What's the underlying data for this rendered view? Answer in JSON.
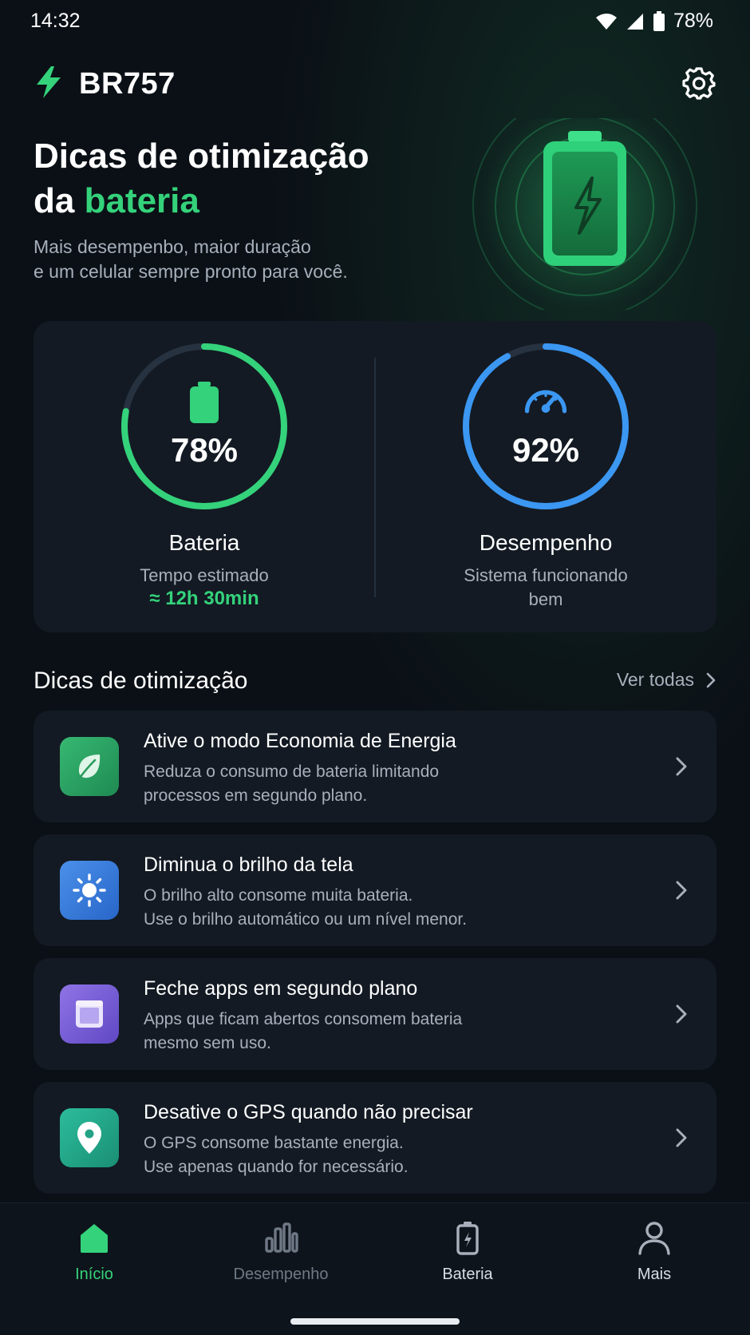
{
  "status_bar": {
    "time": "14:32",
    "battery_percent": "78%"
  },
  "header": {
    "brand": "BR757",
    "icons": [
      "bolt-icon",
      "gear-icon"
    ]
  },
  "hero": {
    "title_line1": "Dicas de otimização",
    "title_line2_prefix": "da ",
    "title_line2_accent": "bateria",
    "subtitle_line1": "Mais desempenbo, maior duração",
    "subtitle_line2": "e um celular sempre pronto para você."
  },
  "stats": {
    "battery": {
      "value_text": "78%",
      "level": 0.78,
      "label": "Bateria",
      "sub": "Tempo estimado",
      "eta": "≈ 12h 30min",
      "color": "#34d27b"
    },
    "performance": {
      "value_text": "92%",
      "level": 0.92,
      "label": "Desempenho",
      "sub_line1": "Sistema funcionando",
      "sub_line2": "bem",
      "color": "#3b97f2"
    }
  },
  "tips_section": {
    "title": "Dicas de otimização",
    "see_all": "Ver todas"
  },
  "tips": [
    {
      "title": "Ative o modo Economia de Energia",
      "desc_line1": "Reduza o consumo de bateria limitando",
      "desc_line2": "processos em segundo plano.",
      "icon": "leaf-icon",
      "color": "#2fae68"
    },
    {
      "title": "Diminua o brilho da tela",
      "desc_line1": "O brilho alto consome muita bateria.",
      "desc_line2": "Use o brilho automático ou um nível menor.",
      "icon": "sun-icon",
      "color": "#3a7fe0"
    },
    {
      "title": "Feche apps em segundo plano",
      "desc_line1": "Apps que ficam abertos consomem bateria",
      "desc_line2": "mesmo sem uso.",
      "icon": "window-icon",
      "color": "#7c63d8"
    },
    {
      "title": "Desative o GPS quando não precisar",
      "desc_line1": "O GPS consome bastante energia.",
      "desc_line2": "Use apenas quando for necessário.",
      "icon": "location-pin-icon",
      "color": "#22a88c"
    }
  ],
  "bottom_nav": {
    "items": [
      {
        "label": "Início",
        "icon": "home-icon",
        "active": true
      },
      {
        "label": "Desempenho",
        "icon": "bar-chart-icon",
        "active": false
      },
      {
        "label": "Bateria",
        "icon": "battery-icon",
        "active": false
      },
      {
        "label": "Mais",
        "icon": "user-icon",
        "active": false
      }
    ],
    "active_color": "#34d27b",
    "inactive_color": "#6f7986"
  }
}
